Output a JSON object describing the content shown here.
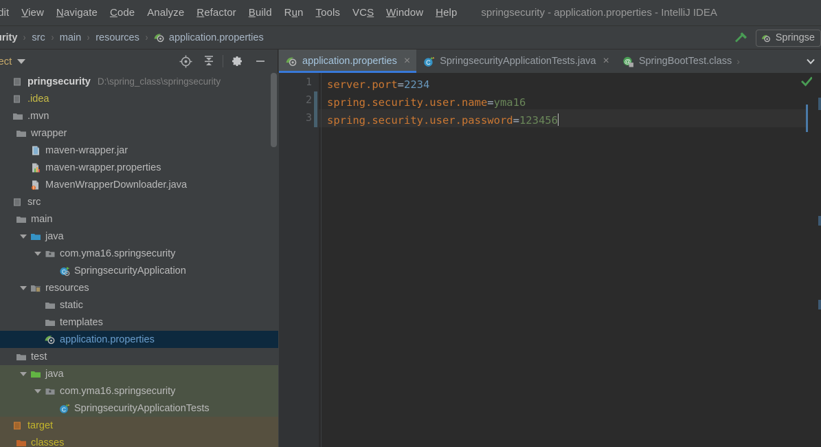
{
  "window": {
    "title": "springsecurity - application.properties - IntelliJ IDEA"
  },
  "menubar": {
    "items": [
      {
        "pre": "",
        "mn": "E",
        "post": "dit"
      },
      {
        "pre": "",
        "mn": "V",
        "post": "iew"
      },
      {
        "pre": "",
        "mn": "N",
        "post": "avigate"
      },
      {
        "pre": "",
        "mn": "C",
        "post": "ode"
      },
      {
        "pre": "Analyze",
        "mn": "",
        "post": ""
      },
      {
        "pre": "",
        "mn": "R",
        "post": "efactor"
      },
      {
        "pre": "",
        "mn": "B",
        "post": "uild"
      },
      {
        "pre": "R",
        "mn": "u",
        "post": "n"
      },
      {
        "pre": "",
        "mn": "T",
        "post": "ools"
      },
      {
        "pre": "VC",
        "mn": "S",
        "post": ""
      },
      {
        "pre": "",
        "mn": "W",
        "post": "indow"
      },
      {
        "pre": "",
        "mn": "H",
        "post": "elp"
      }
    ]
  },
  "navbar": {
    "crumbs": [
      "urity",
      "src",
      "main",
      "resources"
    ],
    "file": "application.properties",
    "run_config": "Springse"
  },
  "project_pane": {
    "title": "ject",
    "tree": [
      {
        "indent": 0,
        "arrow": "none",
        "icon": "module",
        "label": "pringsecurity",
        "style": "root",
        "path": "D:\\spring_class\\springsecurity",
        "row": "normal"
      },
      {
        "indent": 0,
        "arrow": "none",
        "icon": "folder-excl",
        "label": ".idea",
        "style": "yellow",
        "path": "",
        "row": "normal"
      },
      {
        "indent": 0,
        "arrow": "none",
        "icon": "folder-gray",
        "label": ".mvn",
        "style": "plain",
        "path": "",
        "row": "normal"
      },
      {
        "indent": 1,
        "arrow": "none",
        "icon": "folder-gray",
        "label": "wrapper",
        "style": "plain",
        "path": "",
        "row": "normal"
      },
      {
        "indent": 2,
        "arrow": "none",
        "icon": "jar",
        "label": "maven-wrapper.jar",
        "style": "plain",
        "path": "",
        "row": "normal"
      },
      {
        "indent": 2,
        "arrow": "none",
        "icon": "properties",
        "label": "maven-wrapper.properties",
        "style": "plain",
        "path": "",
        "row": "normal"
      },
      {
        "indent": 2,
        "arrow": "none",
        "icon": "java-file",
        "label": "MavenWrapperDownloader.java",
        "style": "plain",
        "path": "",
        "row": "normal"
      },
      {
        "indent": 0,
        "arrow": "none",
        "icon": "module",
        "label": "src",
        "style": "plain",
        "path": "",
        "row": "normal"
      },
      {
        "indent": 1,
        "arrow": "none",
        "icon": "folder-gray",
        "label": "main",
        "style": "plain",
        "path": "",
        "row": "normal"
      },
      {
        "indent": 2,
        "arrow": "down",
        "icon": "folder-blue",
        "label": "java",
        "style": "plain",
        "path": "",
        "row": "normal"
      },
      {
        "indent": 3,
        "arrow": "down",
        "icon": "package",
        "label": "com.yma16.springsecurity",
        "style": "plain",
        "path": "",
        "row": "normal"
      },
      {
        "indent": 4,
        "arrow": "none",
        "icon": "spring-class",
        "label": "SpringsecurityApplication",
        "style": "plain",
        "path": "",
        "row": "normal"
      },
      {
        "indent": 2,
        "arrow": "down",
        "icon": "folder-res",
        "label": "resources",
        "style": "plain",
        "path": "",
        "row": "normal"
      },
      {
        "indent": 3,
        "arrow": "none",
        "icon": "folder-gray",
        "label": "static",
        "style": "plain",
        "path": "",
        "row": "normal"
      },
      {
        "indent": 3,
        "arrow": "none",
        "icon": "folder-gray",
        "label": "templates",
        "style": "plain",
        "path": "",
        "row": "normal"
      },
      {
        "indent": 3,
        "arrow": "none",
        "icon": "spring-prop",
        "label": "application.properties",
        "style": "plain",
        "path": "",
        "row": "selected"
      },
      {
        "indent": 1,
        "arrow": "none",
        "icon": "folder-gray",
        "label": "test",
        "style": "plain",
        "path": "",
        "row": "normal"
      },
      {
        "indent": 2,
        "arrow": "down",
        "icon": "folder-green",
        "label": "java",
        "style": "plain",
        "path": "",
        "row": "test"
      },
      {
        "indent": 3,
        "arrow": "down",
        "icon": "package",
        "label": "com.yma16.springsecurity",
        "style": "plain",
        "path": "",
        "row": "test"
      },
      {
        "indent": 4,
        "arrow": "none",
        "icon": "test-class",
        "label": "SpringsecurityApplicationTests",
        "style": "plain",
        "path": "",
        "row": "test"
      },
      {
        "indent": 0,
        "arrow": "none",
        "icon": "module-excl",
        "label": "target",
        "style": "orange",
        "path": "",
        "row": "target"
      },
      {
        "indent": 1,
        "arrow": "none",
        "icon": "folder-orange",
        "label": "classes",
        "style": "orange",
        "path": "",
        "row": "target"
      }
    ]
  },
  "tabs": [
    {
      "label": "application.properties",
      "icon": "spring-prop",
      "active": true,
      "close": "×"
    },
    {
      "label": "SpringsecurityApplicationTests.java",
      "icon": "test-class",
      "active": false,
      "close": "×"
    },
    {
      "label": "SpringBootTest.class",
      "icon": "annotation-class",
      "active": false,
      "close": ""
    }
  ],
  "editor": {
    "line_numbers": [
      "1",
      "2",
      "3"
    ],
    "lines": [
      {
        "key": "server.port",
        "eq": "=",
        "value": "2234",
        "value_type": "number"
      },
      {
        "key": "spring.security.user.name",
        "eq": "=",
        "value": "yma16",
        "value_type": "string"
      },
      {
        "key": "spring.security.user.password",
        "eq": "=",
        "value": "123456",
        "value_type": "string"
      }
    ],
    "caret_line": 3,
    "inspection_status": "ok"
  },
  "colors": {
    "accent_blue": "#3879d9",
    "selection_blue": "#0d293e",
    "key_orange": "#cc7832",
    "value_green": "#6a8759",
    "number_blue": "#6897bb",
    "editor_bg": "#2b2b2b",
    "panel_bg": "#3c3f41",
    "test_root_bg": "#4b5344",
    "excluded_bg": "#56503f",
    "status_green": "#499c54"
  }
}
